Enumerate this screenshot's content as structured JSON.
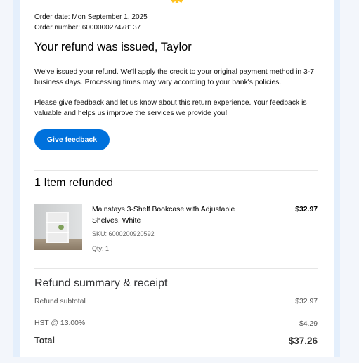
{
  "order": {
    "date": "Order date: Mon September 1, 2025",
    "number": "Order number: 600000027478137"
  },
  "message": {
    "title": "Your refund was issued, Taylor",
    "paragraph1": "We've issued your refund. We'll apply the credit to your original payment method in 3-7 business days. Processing times may vary according to your bank's policies.",
    "paragraph2": "Please give feedback and let us know about this return experience. Your feedback is valuable and helps us improve the services we provide you!",
    "feedback_button": "Give feedback"
  },
  "items": {
    "heading": "1 Item refunded",
    "list": [
      {
        "name": "Mainstays 3-Shelf Bookcase with Adjustable Shelves, White",
        "price": "$32.97",
        "sku": "SKU: 6000200920592",
        "qty": "Qty: 1",
        "image_icon": "bookcase-product-image"
      }
    ]
  },
  "summary": {
    "heading": "Refund summary & receipt",
    "rows": [
      {
        "label": "Refund subtotal",
        "value": "$32.97"
      },
      {
        "label": "HST @ 13.00%",
        "value": "$4.29"
      }
    ],
    "total_label": "Total",
    "total_value": "$37.26"
  },
  "colors": {
    "accent": "#0071dc",
    "logo_spark": "#ffc220",
    "frame": "#e4effc"
  }
}
